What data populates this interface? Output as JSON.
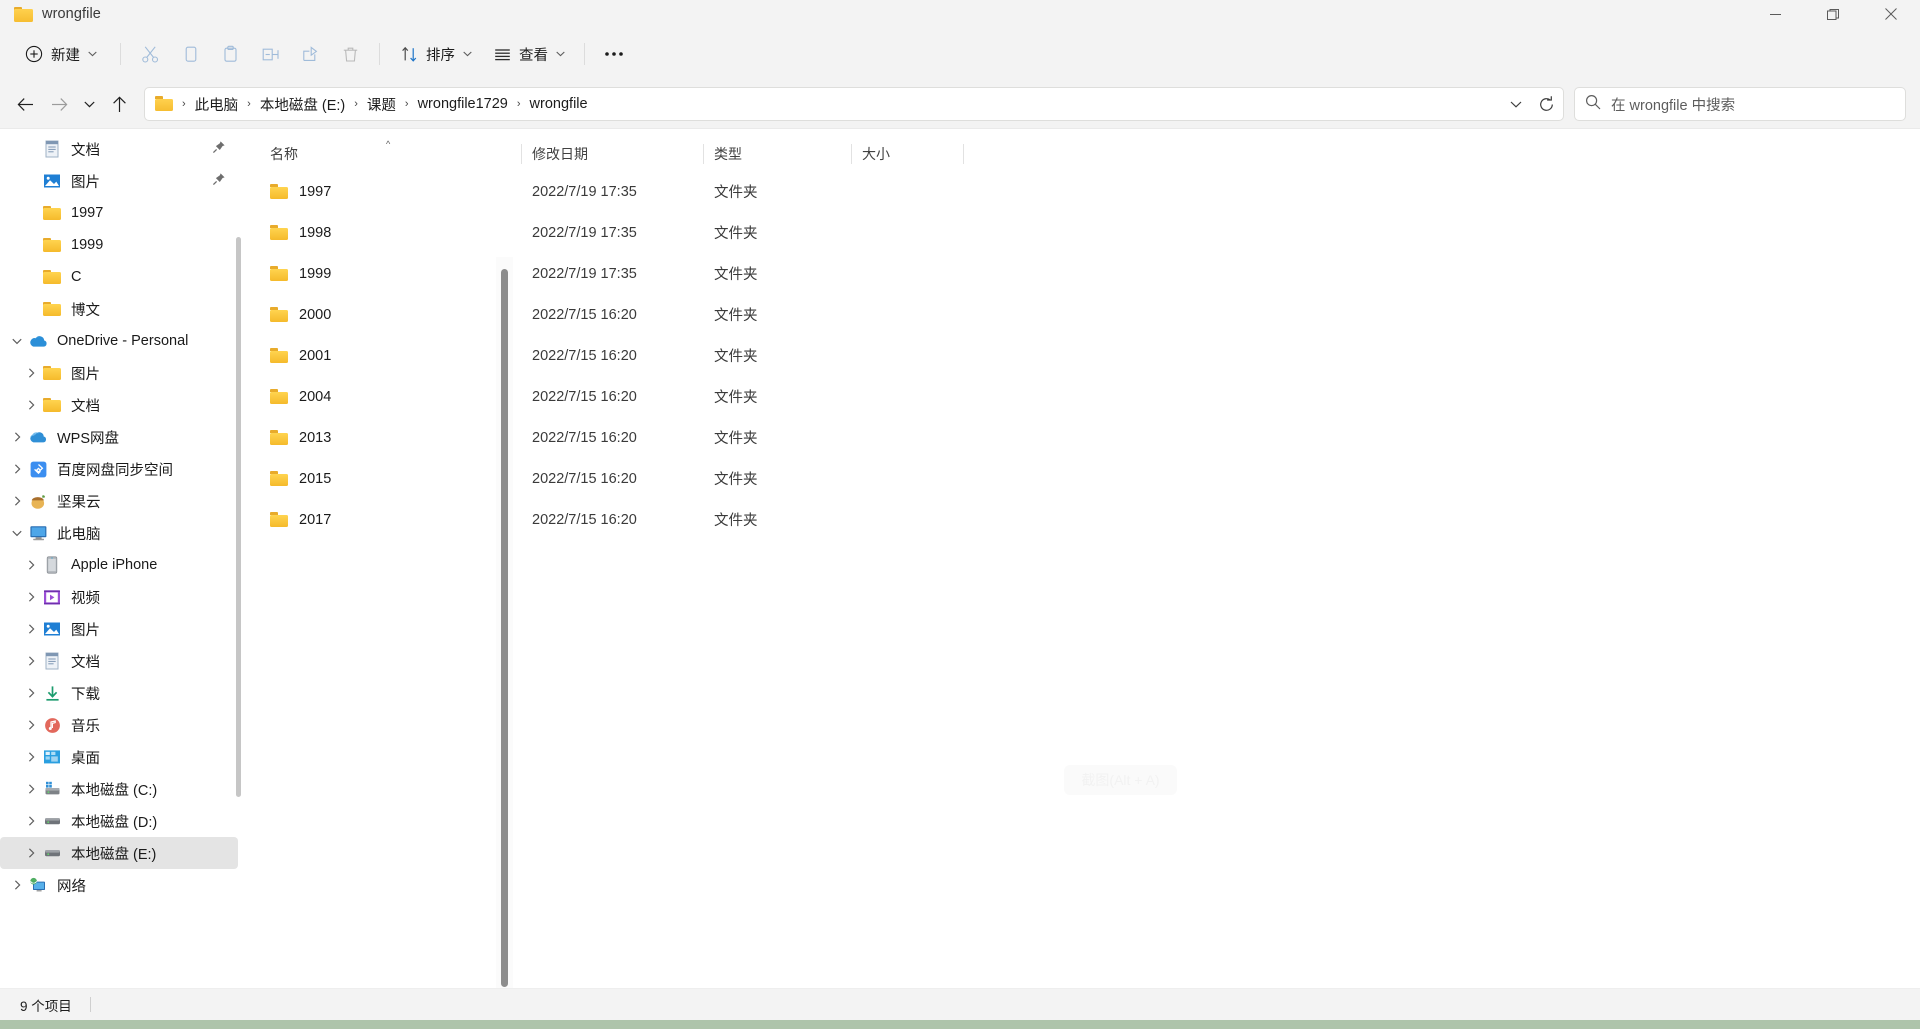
{
  "window": {
    "title": "wrongfile",
    "title_icon": "folder-icon",
    "controls": [
      {
        "name": "minimize",
        "glyph": "minimize-icon"
      },
      {
        "name": "maximize",
        "glyph": "restore-icon"
      },
      {
        "name": "close",
        "glyph": "close-icon"
      }
    ]
  },
  "toolbar": {
    "new_label": "新建",
    "new_icon": "plus-circle-icon",
    "cut_icon": "scissors-icon",
    "copy_icon": "copy-icon",
    "paste_icon": "paste-icon",
    "rename_icon": "rename-icon",
    "share_icon": "share-icon",
    "delete_icon": "trash-icon",
    "sort_label": "排序",
    "sort_icon": "sort-arrows-icon",
    "view_label": "查看",
    "view_icon": "list-lines-icon",
    "more_label": "···",
    "more_icon": "ellipsis-icon"
  },
  "navigation": {
    "back_icon": "arrow-left-icon",
    "forward_icon": "arrow-right-icon",
    "recent_icon": "chevron-down-icon",
    "up_icon": "arrow-up-icon",
    "breadcrumb": [
      "此电脑",
      "本地磁盘 (E:)",
      "课题",
      "wrongfile1729",
      "wrongfile"
    ],
    "breadcrumb_separator": "›",
    "address_dropdown_icon": "chevron-down-icon",
    "refresh_icon": "refresh-icon"
  },
  "search": {
    "placeholder": "在 wrongfile 中搜索",
    "icon": "search-icon"
  },
  "sidebar": {
    "items": [
      {
        "label": "文档",
        "icon": "document-icon",
        "indent": 1,
        "chevron": "",
        "pinned": true,
        "selected": false
      },
      {
        "label": "图片",
        "icon": "picture-icon",
        "indent": 1,
        "chevron": "",
        "pinned": true,
        "selected": false
      },
      {
        "label": "1997",
        "icon": "folder-icon",
        "indent": 1,
        "chevron": "",
        "pinned": false,
        "selected": false
      },
      {
        "label": "1999",
        "icon": "folder-icon",
        "indent": 1,
        "chevron": "",
        "pinned": false,
        "selected": false
      },
      {
        "label": "C",
        "icon": "folder-icon",
        "indent": 1,
        "chevron": "",
        "pinned": false,
        "selected": false
      },
      {
        "label": "博文",
        "icon": "folder-icon",
        "indent": 1,
        "chevron": "",
        "pinned": false,
        "selected": false
      },
      {
        "label": "OneDrive - Personal",
        "icon": "onedrive-icon",
        "indent": 0,
        "chevron": "v",
        "pinned": false,
        "selected": false
      },
      {
        "label": "图片",
        "icon": "folder-icon",
        "indent": 1,
        "chevron": ">",
        "pinned": false,
        "selected": false
      },
      {
        "label": "文档",
        "icon": "folder-icon",
        "indent": 1,
        "chevron": ">",
        "pinned": false,
        "selected": false
      },
      {
        "label": "WPS网盘",
        "icon": "wps-cloud-icon",
        "indent": 0,
        "chevron": ">",
        "pinned": false,
        "selected": false
      },
      {
        "label": "百度网盘同步空间",
        "icon": "baidu-pan-icon",
        "indent": 0,
        "chevron": ">",
        "pinned": false,
        "selected": false
      },
      {
        "label": "坚果云",
        "icon": "nutstore-icon",
        "indent": 0,
        "chevron": ">",
        "pinned": false,
        "selected": false
      },
      {
        "label": "此电脑",
        "icon": "this-pc-icon",
        "indent": 0,
        "chevron": "v",
        "pinned": false,
        "selected": false
      },
      {
        "label": "Apple iPhone",
        "icon": "iphone-icon",
        "indent": 1,
        "chevron": ">",
        "pinned": false,
        "selected": false
      },
      {
        "label": "视频",
        "icon": "video-icon",
        "indent": 1,
        "chevron": ">",
        "pinned": false,
        "selected": false
      },
      {
        "label": "图片",
        "icon": "picture-icon",
        "indent": 1,
        "chevron": ">",
        "pinned": false,
        "selected": false
      },
      {
        "label": "文档",
        "icon": "document-icon",
        "indent": 1,
        "chevron": ">",
        "pinned": false,
        "selected": false
      },
      {
        "label": "下载",
        "icon": "download-icon",
        "indent": 1,
        "chevron": ">",
        "pinned": false,
        "selected": false
      },
      {
        "label": "音乐",
        "icon": "music-icon",
        "indent": 1,
        "chevron": ">",
        "pinned": false,
        "selected": false
      },
      {
        "label": "桌面",
        "icon": "desktop-icon",
        "indent": 1,
        "chevron": ">",
        "pinned": false,
        "selected": false
      },
      {
        "label": "本地磁盘 (C:)",
        "icon": "os-drive-icon",
        "indent": 1,
        "chevron": ">",
        "pinned": false,
        "selected": false
      },
      {
        "label": "本地磁盘 (D:)",
        "icon": "drive-icon",
        "indent": 1,
        "chevron": ">",
        "pinned": false,
        "selected": false
      },
      {
        "label": "本地磁盘 (E:)",
        "icon": "drive-icon",
        "indent": 1,
        "chevron": ">",
        "pinned": false,
        "selected": true
      },
      {
        "label": "网络",
        "icon": "network-icon",
        "indent": 0,
        "chevron": ">",
        "pinned": false,
        "selected": false
      }
    ]
  },
  "filelist": {
    "columns": [
      {
        "label": "名称",
        "key": "name",
        "sorted": true,
        "sort_dir": "asc"
      },
      {
        "label": "修改日期",
        "key": "date",
        "sorted": false,
        "sort_dir": ""
      },
      {
        "label": "类型",
        "key": "type",
        "sorted": false,
        "sort_dir": ""
      },
      {
        "label": "大小",
        "key": "size",
        "sorted": false,
        "sort_dir": ""
      }
    ],
    "sort_caret": "^",
    "rows": [
      {
        "icon": "folder-icon",
        "name": "1997",
        "date": "2022/7/19 17:35",
        "type": "文件夹",
        "size": ""
      },
      {
        "icon": "folder-icon",
        "name": "1998",
        "date": "2022/7/19 17:35",
        "type": "文件夹",
        "size": ""
      },
      {
        "icon": "folder-icon",
        "name": "1999",
        "date": "2022/7/19 17:35",
        "type": "文件夹",
        "size": ""
      },
      {
        "icon": "folder-icon",
        "name": "2000",
        "date": "2022/7/15 16:20",
        "type": "文件夹",
        "size": ""
      },
      {
        "icon": "folder-icon",
        "name": "2001",
        "date": "2022/7/15 16:20",
        "type": "文件夹",
        "size": ""
      },
      {
        "icon": "folder-icon",
        "name": "2004",
        "date": "2022/7/15 16:20",
        "type": "文件夹",
        "size": ""
      },
      {
        "icon": "folder-icon",
        "name": "2013",
        "date": "2022/7/15 16:20",
        "type": "文件夹",
        "size": ""
      },
      {
        "icon": "folder-icon",
        "name": "2015",
        "date": "2022/7/15 16:20",
        "type": "文件夹",
        "size": ""
      },
      {
        "icon": "folder-icon",
        "name": "2017",
        "date": "2022/7/15 16:20",
        "type": "文件夹",
        "size": ""
      }
    ],
    "watermark": "截图(Alt + A)"
  },
  "statusbar": {
    "item_count": "9 个项目"
  },
  "colors": {
    "chrome": "#f3f3f3",
    "folder_yellow": "#ffd14e",
    "selection": "#e4e4e4",
    "accent_blue": "#0078d4",
    "bottom_strip": "#aec4ab"
  }
}
